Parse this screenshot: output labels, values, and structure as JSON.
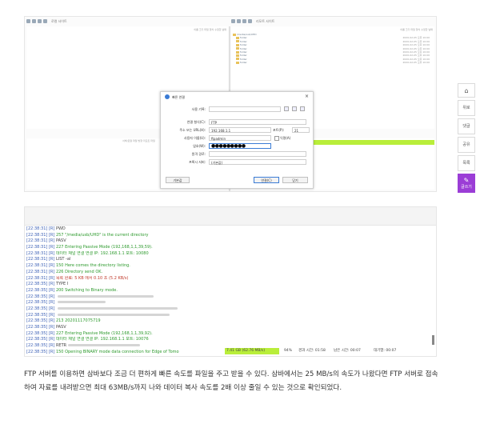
{
  "ftp_client": {
    "left_toolbar_title": "로컬 사이트",
    "right_toolbar_title": "리모트 사이트",
    "left_cols": "이름  크기  파일 형식  수정한 날짜",
    "right_cols": "이름  크기  파일 형식  수정한 날짜",
    "remote_tree": [
      "/media/usb/UHD",
      "folder",
      "folder",
      "folder",
      "folder",
      "folder",
      "folder",
      "folder",
      "folder"
    ],
    "remote_dates": [
      "2020-02-05 오후 10:00",
      "2020-02-05 오후 10:00",
      "2020-02-05 오후 10:00",
      "2020-02-05 오후 10:00",
      "2020-02-05 오후 10:00",
      "2020-02-05 오후 10:00",
      "2020-02-05 오후 10:00",
      "2020-02-05 오후 10:00"
    ],
    "queue_headers": "서버/로컬 파일    방향    리모트 파일"
  },
  "dialog": {
    "title": "빠른 연결",
    "close": "×",
    "site_label": "사용 기록:",
    "site_value": "",
    "conn_type_label": "연결 형식(C):",
    "conn_type_value": "FTP",
    "address_label": "주소 또는 URL(H):",
    "address_value": "192.168.1.1",
    "port_label": "포트(P):",
    "port_value": "21",
    "user_label": "사용자 이름(U):",
    "user_value": "ftpadmin",
    "anon_label": "익명(A)",
    "password_label": "암호(W):",
    "password_value": "●●●●●●●●●",
    "dir_label": "원격 경로:",
    "dir_value": "",
    "server_label": "프록시 서버:",
    "server_value": "(기본값)",
    "btn_default": "기본값",
    "btn_connect": "연결(C)",
    "btn_close": "닫기"
  },
  "log": {
    "lines": [
      {
        "time": "[22:38:31]",
        "dir": "[R]",
        "text": "PWD",
        "cls": "t-dark",
        "blur": 0
      },
      {
        "time": "[22:38:31]",
        "dir": "[R]",
        "text": "257 \"/media/usb/UHD\" is the current directory",
        "cls": "t-green",
        "blur": 0
      },
      {
        "time": "[22:38:31]",
        "dir": "[R]",
        "text": "PASV",
        "cls": "t-dark",
        "blur": 0
      },
      {
        "time": "[22:38:31]",
        "dir": "[R]",
        "text": "227 Entering Passive Mode (192,168,1,1,39,59).",
        "cls": "t-green",
        "blur": 0
      },
      {
        "time": "[22:38:31]",
        "dir": "[R]",
        "text": "데이터 채널 연결 연결 IP: 192.168.1.1 포트: 10080",
        "cls": "t-green",
        "blur": 0
      },
      {
        "time": "[22:38:31]",
        "dir": "[R]",
        "text": "LIST -al",
        "cls": "t-dark",
        "blur": 0
      },
      {
        "time": "[22:38:31]",
        "dir": "[R]",
        "text": "150 Here comes the directory listing.",
        "cls": "t-green",
        "blur": 0
      },
      {
        "time": "[22:38:31]",
        "dir": "[R]",
        "text": "226 Directory send OK.",
        "cls": "t-green",
        "blur": 0
      },
      {
        "time": "[22:38:31]",
        "dir": "[R]",
        "text": "목록 완료: 5 KB 에서 0.10 초 (5.2 KB/s)",
        "cls": "t-red",
        "blur": 0
      },
      {
        "time": "[22:38:35]",
        "dir": "[R]",
        "text": "TYPE I",
        "cls": "t-dark",
        "blur": 0
      },
      {
        "time": "[22:38:35]",
        "dir": "[R]",
        "text": "200 Switching to Binary mode.",
        "cls": "t-green",
        "blur": 0
      },
      {
        "time": "[22:38:35]",
        "dir": "[R]",
        "text": "",
        "cls": "t-dark",
        "blur": 120
      },
      {
        "time": "[22:38:35]",
        "dir": "[R]",
        "text": "",
        "cls": "t-green",
        "blur": 60
      },
      {
        "time": "[22:38:35]",
        "dir": "[R]",
        "text": "",
        "cls": "t-dark",
        "blur": 150
      },
      {
        "time": "[22:38:35]",
        "dir": "[R]",
        "text": "",
        "cls": "t-green",
        "blur": 140
      },
      {
        "time": "[22:38:35]",
        "dir": "[R]",
        "text": "213 20201117075719",
        "cls": "t-green",
        "blur": 0
      },
      {
        "time": "[22:38:35]",
        "dir": "[R]",
        "text": "PASV",
        "cls": "t-dark",
        "blur": 0
      },
      {
        "time": "[22:38:35]",
        "dir": "[R]",
        "text": "227 Entering Passive Mode (192,168,1,1,39,92).",
        "cls": "t-green",
        "blur": 0
      },
      {
        "time": "[22:38:35]",
        "dir": "[R]",
        "text": "데이터 채널 연결 연결 IP: 192.168.1.1 포트: 10076",
        "cls": "t-green",
        "blur": 0
      },
      {
        "time": "[22:38:35]",
        "dir": "[R]",
        "text": "RETR",
        "cls": "t-dark",
        "blur": 90
      },
      {
        "time": "[22:38:35]",
        "dir": "[R]",
        "text": "150 Opening BINARY mode data connection for Edge of Tomo",
        "cls": "t-green",
        "blur": 0
      }
    ],
    "status": {
      "transferred": "7.41 GB (62.76 MB/s)",
      "percent": "94%",
      "elapsed": "경과 시간: 01:58",
      "remaining": "남은 시간: 00:07",
      "queue": "대기열: 00:07"
    }
  },
  "side_menu": {
    "top_icon": "⌂",
    "btn1": "위로",
    "btn2": "댓글",
    "btn3": "공유",
    "btn4": "목록",
    "write_icon": "✎",
    "write_label": "글쓰기"
  },
  "paragraph": {
    "text": "FTP 서버를 이용하면 삼바보다 조금 더 편하게 빠른 속도를 파일을 주고 받을 수 있다. 삼바에서는 25 MB/s의 속도가 나왔다면 FTP 서버로 접속하여 자료를 내려받으면 최대 63MB/s까지 나와 데이터 복사 속도를 2배 이상 줄일 수 있는 것으로 확인되었다."
  }
}
